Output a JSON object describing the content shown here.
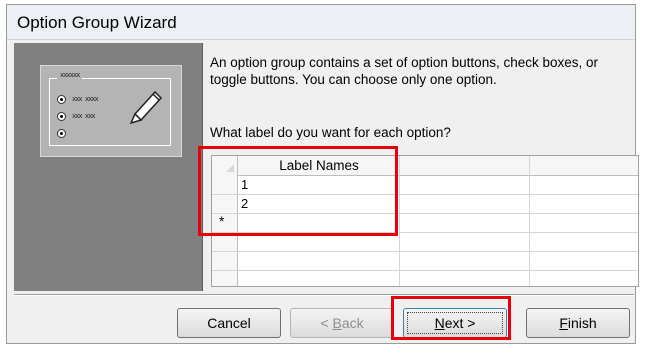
{
  "window": {
    "title": "Option Group Wizard"
  },
  "illustration": {
    "frame_label": "xxxxxx",
    "option_1": "xxx xxxx",
    "option_2": "xxx xxx"
  },
  "description": "An option group contains a set of option buttons, check boxes, or toggle buttons. You can choose only one option.",
  "question": "What label do you want for each option?",
  "grid": {
    "column_header": "Label Names",
    "rows": [
      "1",
      "2"
    ],
    "new_row_marker": "*"
  },
  "buttons": {
    "cancel": {
      "prefix": "Cancel",
      "mnemonic": "",
      "suffix": ""
    },
    "back": {
      "prefix": "< ",
      "mnemonic": "B",
      "suffix": "ack"
    },
    "next": {
      "prefix": "",
      "mnemonic": "N",
      "suffix": "ext >"
    },
    "finish": {
      "prefix": "",
      "mnemonic": "F",
      "suffix": "inish"
    }
  },
  "highlight_color": "#e8000b"
}
